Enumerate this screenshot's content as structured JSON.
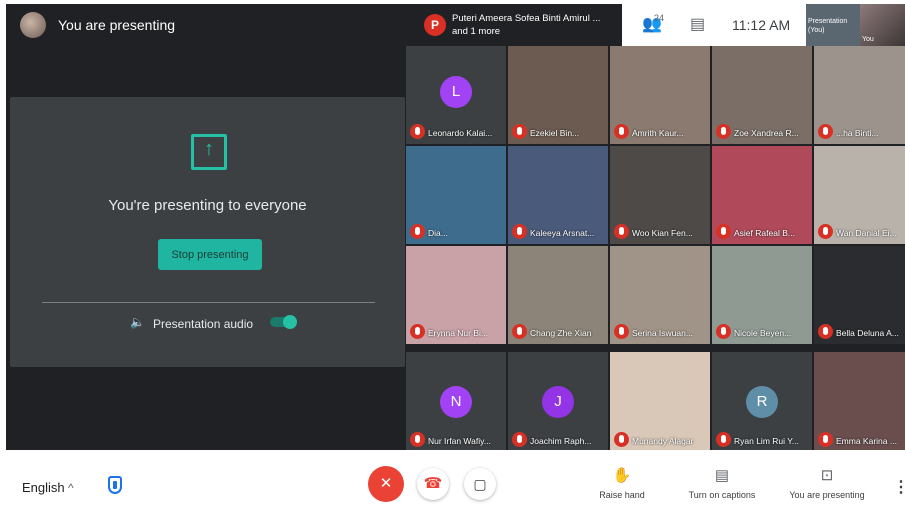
{
  "header": {
    "presenting_title": "You are presenting",
    "presenter_badge": "P",
    "presenter_name": "Puteri Ameera Sofea Binti Amirul ...",
    "presenter_more": "and 1 more",
    "people_count": "24",
    "time": "11:12 AM",
    "self_tile_label_1": "Presentation",
    "self_tile_label_2": "(You)",
    "self_cam_label": "You"
  },
  "presentation": {
    "heading": "You're presenting to everyone",
    "stop_label": "Stop presenting",
    "audio_label": "Presentation audio",
    "audio_on": true
  },
  "participants": [
    {
      "name": "Leonardo Kalai...",
      "initial": "L",
      "color": "#a142f4"
    },
    {
      "name": "Ezekiel Bin...",
      "initial": "",
      "color": "#6b5b50"
    },
    {
      "name": "Amrith Kaur...",
      "initial": "",
      "color": "#8a7a70"
    },
    {
      "name": "Zoe Xandrea R...",
      "initial": "",
      "color": "#7a6e66"
    },
    {
      "name": "...ha Binti...",
      "initial": "",
      "color": "#9c948c"
    },
    {
      "name": "Dia...",
      "initial": "",
      "color": "#3e6c8c"
    },
    {
      "name": "Kaleeya Arsnat...",
      "initial": "",
      "color": "#4a5a7a"
    },
    {
      "name": "Woo Kian Fen...",
      "initial": "",
      "color": "#4d4a48"
    },
    {
      "name": "Asief Rafeal B...",
      "initial": "",
      "color": "#b04a5a"
    },
    {
      "name": "Wan Danial Ei...",
      "initial": "",
      "color": "#b8b2aa"
    },
    {
      "name": "Erynna Nur Bi...",
      "initial": "",
      "color": "#c9a2a8"
    },
    {
      "name": "Chang Zhe Xian",
      "initial": "",
      "color": "#8c8478"
    },
    {
      "name": "Serina Iswuan...",
      "initial": "",
      "color": "#a09488"
    },
    {
      "name": "Nicole Beyen...",
      "initial": "",
      "color": "#8e9a92"
    },
    {
      "name": "Bella Deluna A...",
      "initial": "",
      "color": "#2a2c30"
    },
    {
      "name": "Nur Irfan Wafiy...",
      "initial": "N",
      "color": "#a142f4"
    },
    {
      "name": "Joachim Raph...",
      "initial": "J",
      "color": "#9334e6"
    },
    {
      "name": "Munandy Alagar",
      "initial": "",
      "color": "#d9c8b8"
    },
    {
      "name": "Ryan Lim Rui Y...",
      "initial": "R",
      "color": "#5f8fa8"
    },
    {
      "name": "Emma Karina ...",
      "initial": "",
      "color": "#6a4e4e"
    }
  ],
  "footer": {
    "language": "English",
    "raise_hand": "Raise hand",
    "captions": "Turn on captions",
    "presenting": "You are presenting"
  }
}
